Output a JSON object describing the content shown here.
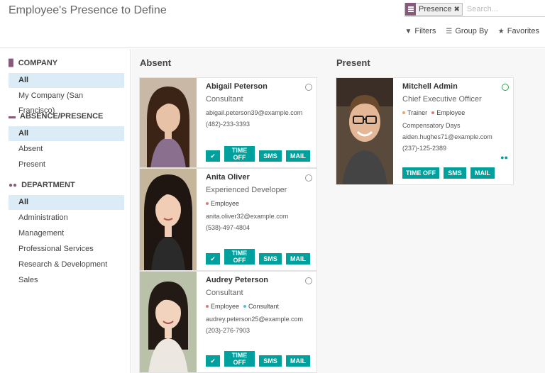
{
  "page": {
    "title": "Employee's Presence to Define"
  },
  "search": {
    "facet": "Presence",
    "placeholder": "Search...",
    "filters_label": "Filters",
    "groupby_label": "Group By",
    "favorites_label": "Favorites"
  },
  "sidebar": {
    "company": {
      "header": "COMPANY",
      "items": [
        "All",
        "My Company (San Francisco)"
      ]
    },
    "presence": {
      "header": "ABSENCE/PRESENCE",
      "items": [
        "All",
        "Absent",
        "Present"
      ]
    },
    "department": {
      "header": "DEPARTMENT",
      "items": [
        "All",
        "Administration",
        "Management",
        "Professional Services",
        "Research & Development",
        "Sales"
      ]
    }
  },
  "columns": {
    "absent": "Absent",
    "present": "Present"
  },
  "buttons": {
    "time_off_line1": "TIME",
    "time_off_line2": "OFF",
    "sms": "SMS",
    "mail": "MAIL"
  },
  "employees": [
    {
      "name": "Abigail Peterson",
      "job": "Consultant",
      "email": "abigail.peterson39@example.com",
      "phone": "(482)-233-3393"
    },
    {
      "name": "Anita Oliver",
      "job": "Experienced Developer",
      "tag1": "Employee",
      "email": "anita.oliver32@example.com",
      "phone": "(538)-497-4804"
    },
    {
      "name": "Audrey Peterson",
      "job": "Consultant",
      "tag1": "Employee",
      "tag2": "Consultant",
      "email": "audrey.peterson25@example.com",
      "phone": "(203)-276-7903"
    },
    {
      "name": "Mitchell Admin",
      "job": "Chief Executive Officer",
      "tag1": "Trainer",
      "tag2": "Employee",
      "note": "Compensatory Days",
      "email": "aiden.hughes71@example.com",
      "phone": "(237)-125-2389"
    }
  ],
  "colors": {
    "accent": "#00a09d",
    "brand": "#875a7b",
    "trainer_tag": "#f0a35a",
    "employee_tag": "#e07a7a",
    "consultant_tag": "#4fc3d9"
  }
}
